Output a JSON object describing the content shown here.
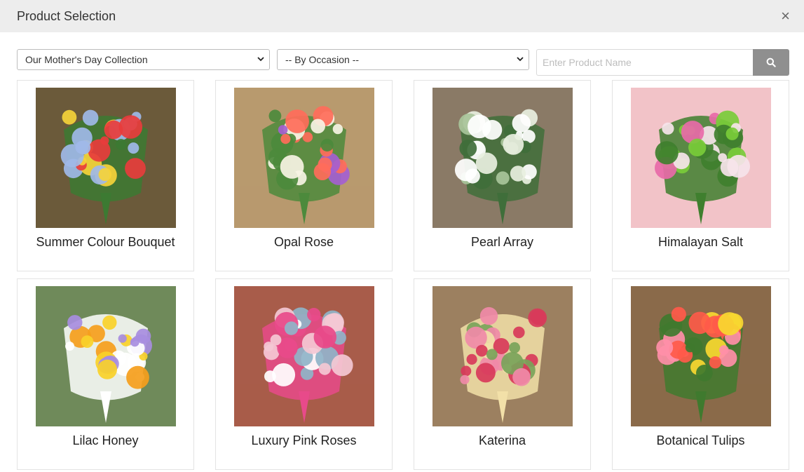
{
  "dialog": {
    "title": "Product Selection",
    "close_label": "×"
  },
  "filters": {
    "collection": "Our Mother's Day Collection",
    "occasion": "-- By Occasion --",
    "search_placeholder": "Enter Product Name",
    "search_icon": "search-icon"
  },
  "products": [
    {
      "name": "Summer Colour Bouquet",
      "palette": [
        "#6b5a3a",
        "#e83c3c",
        "#f5d23a",
        "#9fb8e8",
        "#3c7a32"
      ]
    },
    {
      "name": "Opal Rose",
      "palette": [
        "#b89a6e",
        "#ff6d5a",
        "#a45fd0",
        "#f7f3e4",
        "#4c8a3c"
      ]
    },
    {
      "name": "Pearl Array",
      "palette": [
        "#8a7a66",
        "#ffffff",
        "#e8efe0",
        "#a8c49a",
        "#3f6e3a"
      ]
    },
    {
      "name": "Himalayan Salt",
      "palette": [
        "#f2c3c8",
        "#e86aa8",
        "#7acc3a",
        "#f6e4ea",
        "#3f7f2e"
      ]
    },
    {
      "name": "Lilac Honey",
      "palette": [
        "#6f8a5a",
        "#f8d12a",
        "#f59e1c",
        "#a78de0",
        "#ffffff"
      ]
    },
    {
      "name": "Luxury Pink Roses",
      "palette": [
        "#a85c4a",
        "#f4c8d4",
        "#ffffff",
        "#8fb4c8",
        "#e84a8a"
      ]
    },
    {
      "name": "Katerina",
      "palette": [
        "#9c8060",
        "#f08aa8",
        "#d83a5a",
        "#7aa35a",
        "#f2e0a8"
      ]
    },
    {
      "name": "Botanical Tulips",
      "palette": [
        "#8a6a4a",
        "#ff5a4a",
        "#f8d830",
        "#ff8fa8",
        "#3f7a2e"
      ]
    }
  ]
}
